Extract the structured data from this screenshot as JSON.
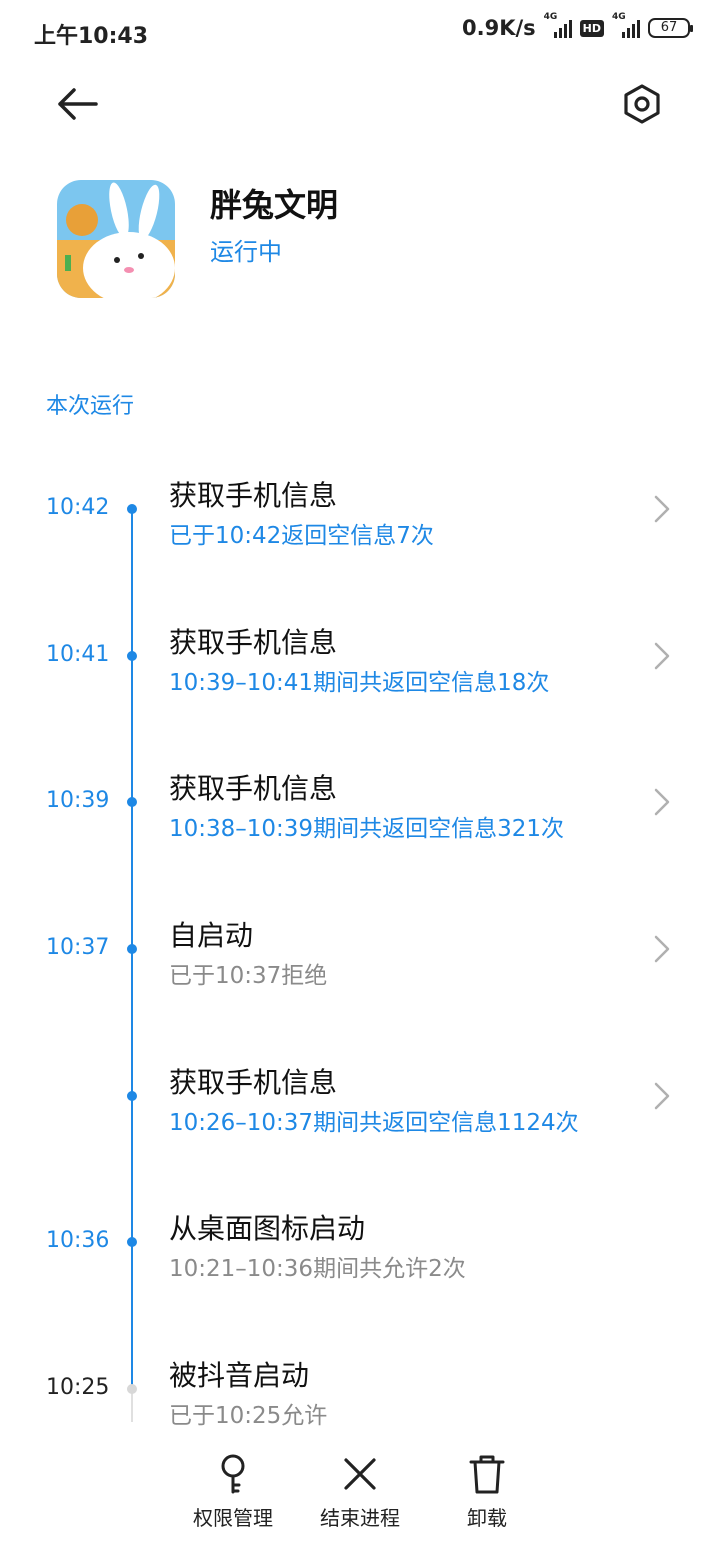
{
  "status_bar": {
    "time": "上午10:43",
    "network_speed": "0.9K/s",
    "signal_1_tag": "4G",
    "hd_badge": "HD",
    "signal_2_tag": "4G",
    "battery": "67"
  },
  "app": {
    "name": "胖兔文明",
    "status": "运行中"
  },
  "section_title": "本次运行",
  "timeline": [
    {
      "time": "10:42",
      "title": "获取手机信息",
      "subtitle": "已于10:42返回空信息7次"
    },
    {
      "time": "10:41",
      "title": "获取手机信息",
      "subtitle": "10:39–10:41期间共返回空信息18次"
    },
    {
      "time": "10:39",
      "title": "获取手机信息",
      "subtitle": "10:38–10:39期间共返回空信息321次"
    },
    {
      "time": "10:37",
      "title": "自启动",
      "subtitle": "已于10:37拒绝"
    },
    {
      "time": "",
      "title": "获取手机信息",
      "subtitle": "10:26–10:37期间共返回空信息1124次"
    },
    {
      "time": "10:36",
      "title": "从桌面图标启动",
      "subtitle": "10:21–10:36期间共允许2次"
    },
    {
      "time": "10:25",
      "title": "被抖音启动",
      "subtitle": "已于10:25允许"
    }
  ],
  "bottom_bar": {
    "permissions": "权限管理",
    "end_process": "结束进程",
    "uninstall": "卸载"
  },
  "colors": {
    "accent": "#1e88e5",
    "gray_text": "#8a8a8a"
  },
  "icons": [
    "back-arrow-icon",
    "settings-hex-icon",
    "chevron-right-icon",
    "key-icon",
    "close-icon",
    "trash-icon"
  ]
}
